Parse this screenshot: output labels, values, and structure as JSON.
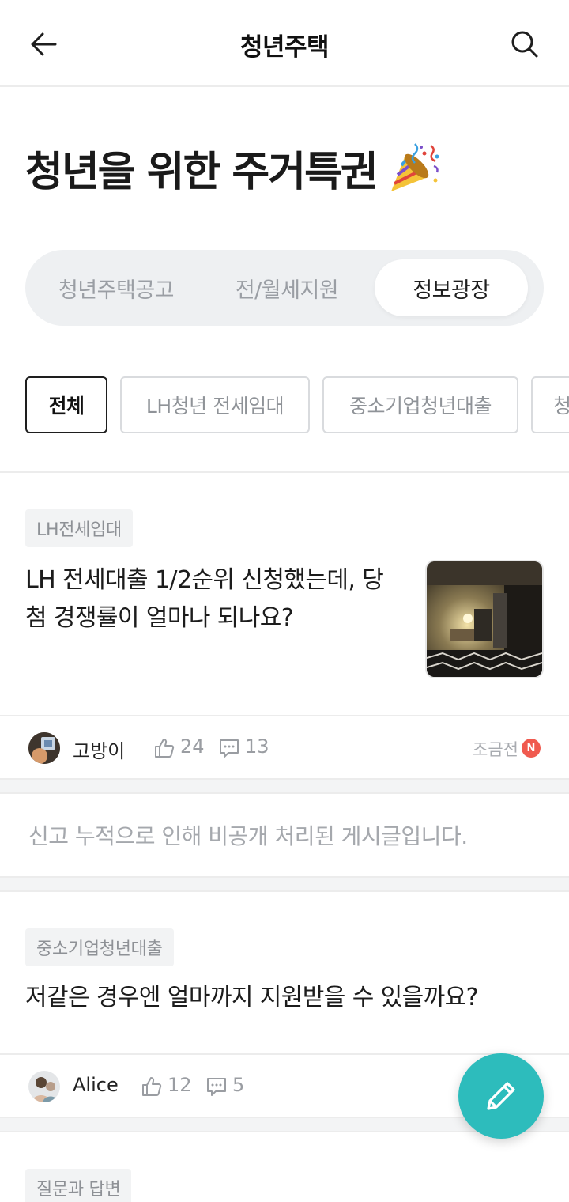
{
  "header": {
    "title": "청년주택",
    "back_icon": "arrow-left-icon",
    "search_icon": "search-icon"
  },
  "hero": {
    "title": "청년을 위한 주거특권",
    "emoji_icon": "party-popper-icon"
  },
  "segments": [
    {
      "label": "청년주택공고",
      "selected": false
    },
    {
      "label": "전/월세지원",
      "selected": false
    },
    {
      "label": "정보광장",
      "selected": true
    }
  ],
  "chips": [
    {
      "label": "전체",
      "selected": true
    },
    {
      "label": "LH청년 전세임대",
      "selected": false
    },
    {
      "label": "중소기업청년대출",
      "selected": false
    },
    {
      "label": "청",
      "selected": false
    }
  ],
  "posts": [
    {
      "tag": "LH전세임대",
      "title_line1": "LH 전세대출 1/2순위 신청했는데, 당",
      "title_line2": "첨 경쟁률이 얼마나 되나요?",
      "author": "고방이",
      "likes": "24",
      "comments": "13",
      "time": "조금전",
      "new_badge": "N"
    },
    {
      "tag": "중소기업청년대출",
      "title_line1": "저같은 경우엔 얼마까지 지원받을 수 있을까요?",
      "author": "Alice",
      "likes": "12",
      "comments": "5"
    },
    {
      "tag": "질문과 답변"
    }
  ],
  "hidden_notice": "신고 누적으로 인해 비공개 처리된 게시글입니다.",
  "fab": {
    "icon": "pencil-icon"
  },
  "colors": {
    "accent": "#2dbcbc",
    "badge_red": "#f05a4f",
    "segment_bg": "#eef0f2"
  }
}
